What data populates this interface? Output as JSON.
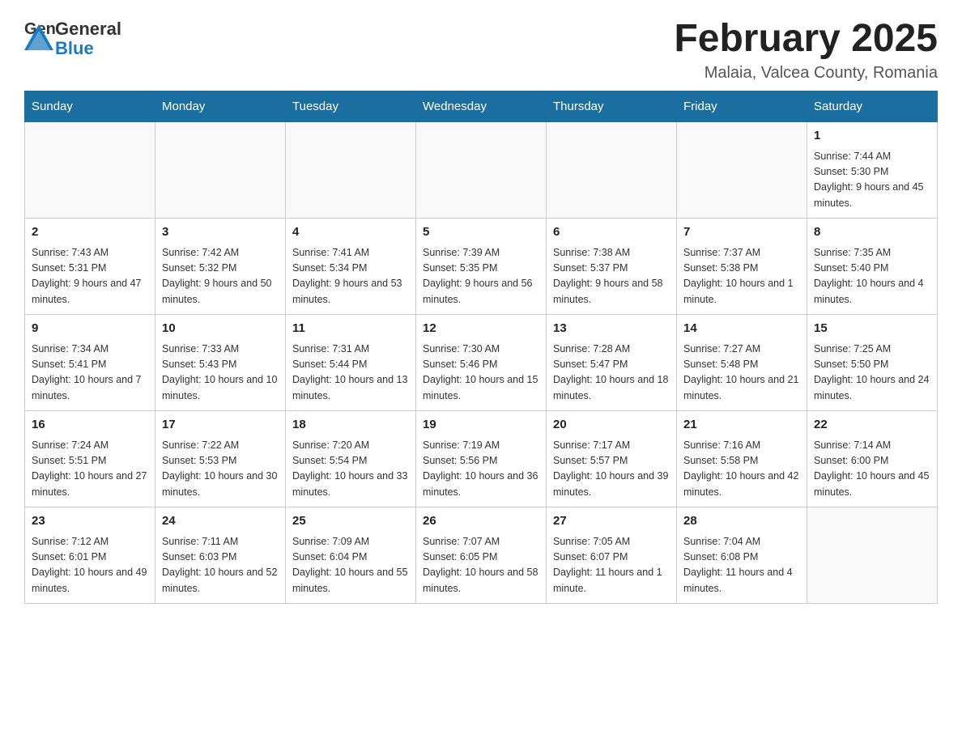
{
  "header": {
    "title": "February 2025",
    "subtitle": "Malaia, Valcea County, Romania"
  },
  "logo": {
    "text_general": "General",
    "text_blue": "Blue"
  },
  "weekdays": [
    "Sunday",
    "Monday",
    "Tuesday",
    "Wednesday",
    "Thursday",
    "Friday",
    "Saturday"
  ],
  "weeks": [
    [
      {
        "day": "",
        "info": ""
      },
      {
        "day": "",
        "info": ""
      },
      {
        "day": "",
        "info": ""
      },
      {
        "day": "",
        "info": ""
      },
      {
        "day": "",
        "info": ""
      },
      {
        "day": "",
        "info": ""
      },
      {
        "day": "1",
        "info": "Sunrise: 7:44 AM\nSunset: 5:30 PM\nDaylight: 9 hours and 45 minutes."
      }
    ],
    [
      {
        "day": "2",
        "info": "Sunrise: 7:43 AM\nSunset: 5:31 PM\nDaylight: 9 hours and 47 minutes."
      },
      {
        "day": "3",
        "info": "Sunrise: 7:42 AM\nSunset: 5:32 PM\nDaylight: 9 hours and 50 minutes."
      },
      {
        "day": "4",
        "info": "Sunrise: 7:41 AM\nSunset: 5:34 PM\nDaylight: 9 hours and 53 minutes."
      },
      {
        "day": "5",
        "info": "Sunrise: 7:39 AM\nSunset: 5:35 PM\nDaylight: 9 hours and 56 minutes."
      },
      {
        "day": "6",
        "info": "Sunrise: 7:38 AM\nSunset: 5:37 PM\nDaylight: 9 hours and 58 minutes."
      },
      {
        "day": "7",
        "info": "Sunrise: 7:37 AM\nSunset: 5:38 PM\nDaylight: 10 hours and 1 minute."
      },
      {
        "day": "8",
        "info": "Sunrise: 7:35 AM\nSunset: 5:40 PM\nDaylight: 10 hours and 4 minutes."
      }
    ],
    [
      {
        "day": "9",
        "info": "Sunrise: 7:34 AM\nSunset: 5:41 PM\nDaylight: 10 hours and 7 minutes."
      },
      {
        "day": "10",
        "info": "Sunrise: 7:33 AM\nSunset: 5:43 PM\nDaylight: 10 hours and 10 minutes."
      },
      {
        "day": "11",
        "info": "Sunrise: 7:31 AM\nSunset: 5:44 PM\nDaylight: 10 hours and 13 minutes."
      },
      {
        "day": "12",
        "info": "Sunrise: 7:30 AM\nSunset: 5:46 PM\nDaylight: 10 hours and 15 minutes."
      },
      {
        "day": "13",
        "info": "Sunrise: 7:28 AM\nSunset: 5:47 PM\nDaylight: 10 hours and 18 minutes."
      },
      {
        "day": "14",
        "info": "Sunrise: 7:27 AM\nSunset: 5:48 PM\nDaylight: 10 hours and 21 minutes."
      },
      {
        "day": "15",
        "info": "Sunrise: 7:25 AM\nSunset: 5:50 PM\nDaylight: 10 hours and 24 minutes."
      }
    ],
    [
      {
        "day": "16",
        "info": "Sunrise: 7:24 AM\nSunset: 5:51 PM\nDaylight: 10 hours and 27 minutes."
      },
      {
        "day": "17",
        "info": "Sunrise: 7:22 AM\nSunset: 5:53 PM\nDaylight: 10 hours and 30 minutes."
      },
      {
        "day": "18",
        "info": "Sunrise: 7:20 AM\nSunset: 5:54 PM\nDaylight: 10 hours and 33 minutes."
      },
      {
        "day": "19",
        "info": "Sunrise: 7:19 AM\nSunset: 5:56 PM\nDaylight: 10 hours and 36 minutes."
      },
      {
        "day": "20",
        "info": "Sunrise: 7:17 AM\nSunset: 5:57 PM\nDaylight: 10 hours and 39 minutes."
      },
      {
        "day": "21",
        "info": "Sunrise: 7:16 AM\nSunset: 5:58 PM\nDaylight: 10 hours and 42 minutes."
      },
      {
        "day": "22",
        "info": "Sunrise: 7:14 AM\nSunset: 6:00 PM\nDaylight: 10 hours and 45 minutes."
      }
    ],
    [
      {
        "day": "23",
        "info": "Sunrise: 7:12 AM\nSunset: 6:01 PM\nDaylight: 10 hours and 49 minutes."
      },
      {
        "day": "24",
        "info": "Sunrise: 7:11 AM\nSunset: 6:03 PM\nDaylight: 10 hours and 52 minutes."
      },
      {
        "day": "25",
        "info": "Sunrise: 7:09 AM\nSunset: 6:04 PM\nDaylight: 10 hours and 55 minutes."
      },
      {
        "day": "26",
        "info": "Sunrise: 7:07 AM\nSunset: 6:05 PM\nDaylight: 10 hours and 58 minutes."
      },
      {
        "day": "27",
        "info": "Sunrise: 7:05 AM\nSunset: 6:07 PM\nDaylight: 11 hours and 1 minute."
      },
      {
        "day": "28",
        "info": "Sunrise: 7:04 AM\nSunset: 6:08 PM\nDaylight: 11 hours and 4 minutes."
      },
      {
        "day": "",
        "info": ""
      }
    ]
  ]
}
